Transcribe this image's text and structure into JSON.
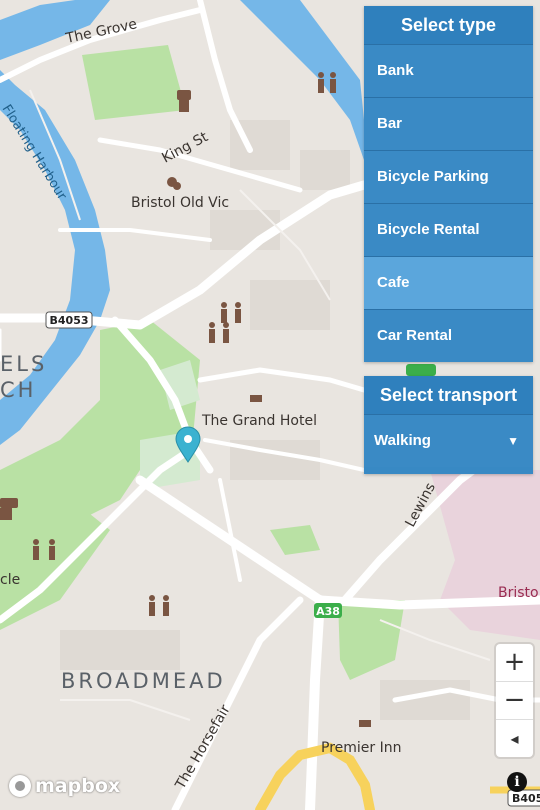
{
  "map": {
    "labels": {
      "the_grove": "The Grove",
      "floating_harbour": "Floating Harbour",
      "king_st": "King St",
      "bristol_old_vic": "Bristol Old Vic",
      "grand_hotel": "The Grand Hotel",
      "broadmead": "BROADMEAD",
      "the_horsefair": "The Horsefair",
      "premier_inn": "Premier Inn",
      "lewins": "Lewins",
      "bristo": "Bristo",
      "els": "ELS",
      "ch": "CH",
      "cle": "cle"
    },
    "shields": {
      "b4053": "B4053",
      "a38": "A38",
      "b405": "B405",
      "a38_partial": "A38"
    }
  },
  "type_panel": {
    "title": "Select type",
    "items": [
      {
        "label": "Bank"
      },
      {
        "label": "Bar"
      },
      {
        "label": "Bicycle Parking"
      },
      {
        "label": "Bicycle Rental"
      },
      {
        "label": "Cafe"
      },
      {
        "label": "Car Rental"
      }
    ],
    "selected_index": 4
  },
  "transport_panel": {
    "title": "Select transport",
    "selected": "Walking"
  },
  "zoom_controls": {
    "zoom_in": "+",
    "zoom_out": "−",
    "compass": "◂"
  },
  "attribution": {
    "logo_text": "mapbox",
    "info_icon": "i"
  },
  "colors": {
    "panel": "#3889c4",
    "selected_item": "#5ba6dc",
    "water": "#73b6e6",
    "park": "#b8e3a0",
    "marker": "#3bb2d0"
  }
}
